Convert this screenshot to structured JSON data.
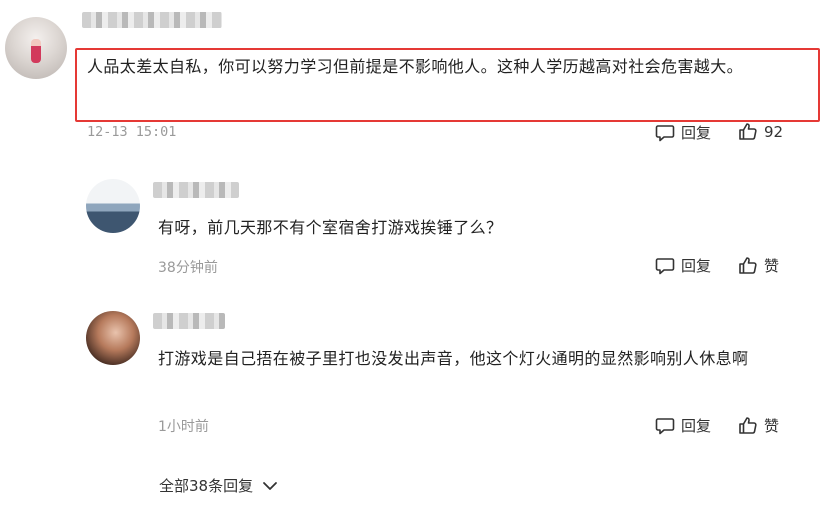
{
  "comments": [
    {
      "text": "人品太差太自私，你可以努力学习但前提是不影响他人。这种人学历越高对社会危害越大。",
      "time": "12-13 15:01",
      "reply_label": "回复",
      "like_label": "92"
    },
    {
      "text": "有呀，前几天那不有个室宿舍打游戏挨锤了么？",
      "time": "38分钟前",
      "reply_label": "回复",
      "like_label": "赞"
    },
    {
      "text": "打游戏是自己捂在被子里打也没发出声音，他这个灯火通明的显然影响别人休息啊",
      "time": "1小时前",
      "reply_label": "回复",
      "like_label": "赞"
    }
  ],
  "all_replies_label": "全部38条回复",
  "colors": {
    "highlight": "#e53935",
    "muted": "#9a9a9a"
  }
}
